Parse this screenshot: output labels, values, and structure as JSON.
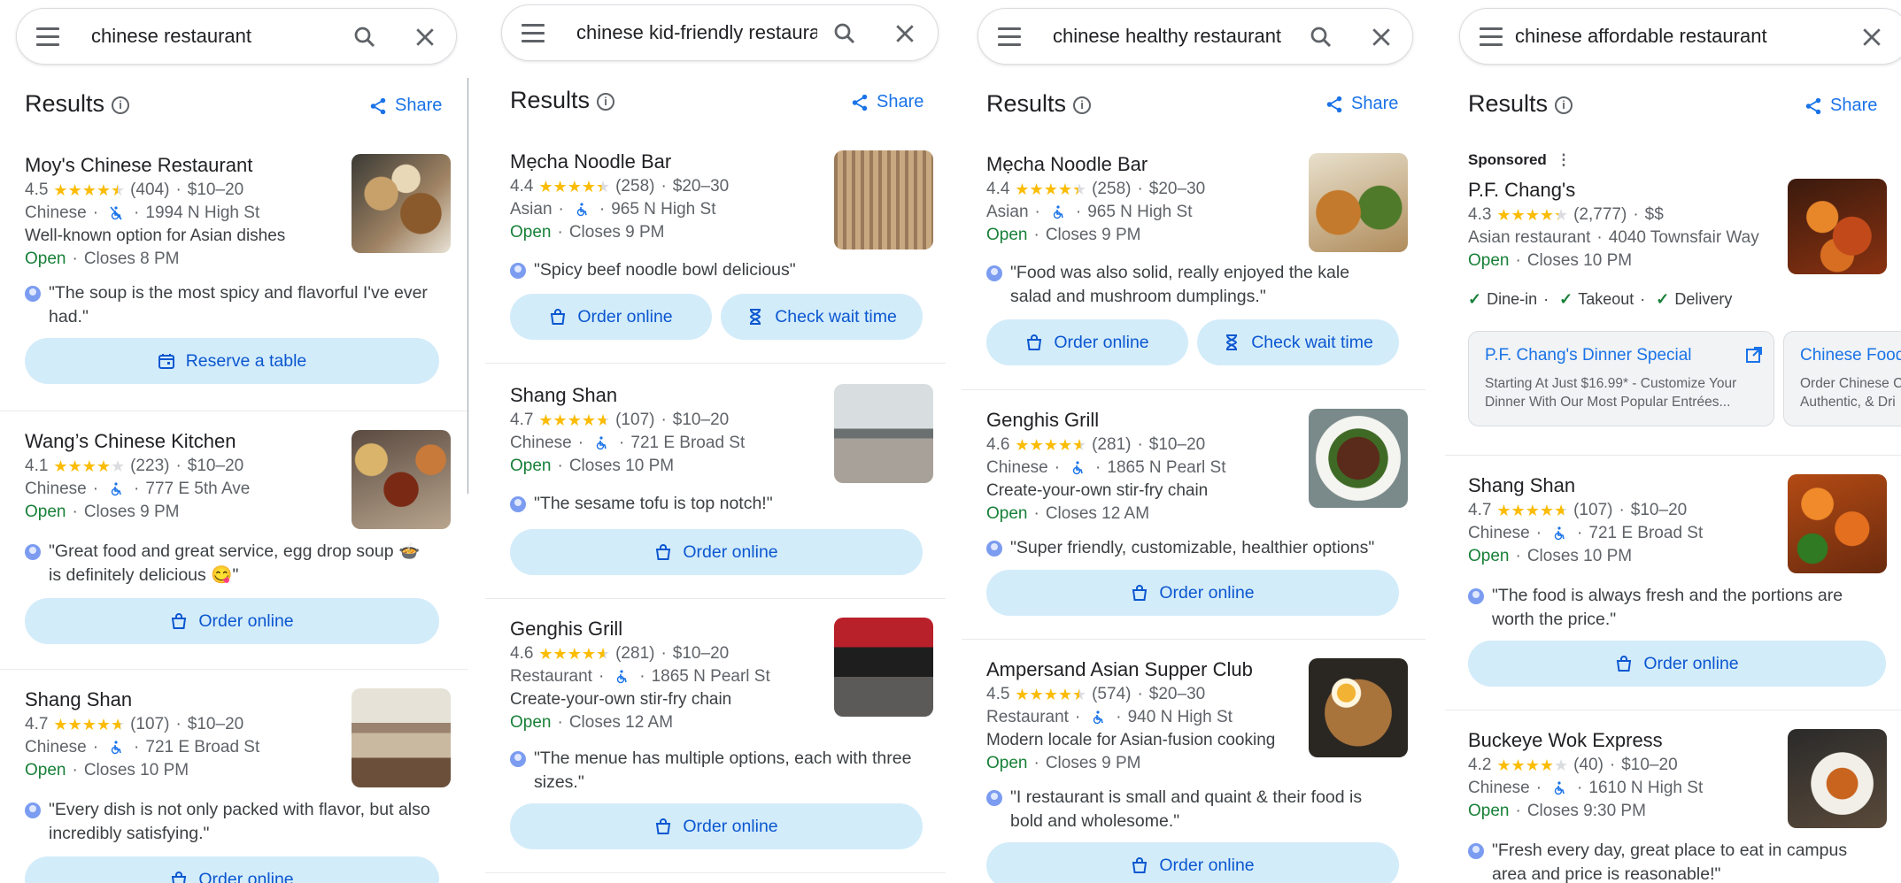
{
  "columns": [
    {
      "query": "chinese restaurant",
      "results_label": "Results",
      "share_label": "Share",
      "items": [
        {
          "name": "Moy's Chinese Restaurant",
          "rating": "4.5",
          "stars": 4.5,
          "reviews": "(404)",
          "price": "$10–20",
          "category": "Chinese",
          "address": "1994 N High St",
          "access": "no-wheelchair",
          "desc": "Well-known option for Asian dishes",
          "status": "Open",
          "closes": "Closes 8 PM",
          "review": "\"The soup is the most spicy and flavorful I've ever had.\"",
          "action": "Reserve a table",
          "photo": "grilled-platter"
        },
        {
          "name": "Wang’s Chinese Kitchen",
          "rating": "4.1",
          "stars": 4,
          "reviews": "(223)",
          "price": "$10–20",
          "category": "Chinese",
          "address": "777 E 5th Ave",
          "access": "wheelchair",
          "desc": "",
          "status": "Open",
          "closes": "Closes 9 PM",
          "review": "\"Great food and great service, egg drop soup 🍲 is definitely delicious 😋\"",
          "action": "Order online",
          "photo": "buffet-tray"
        },
        {
          "name": "Shang Shan",
          "rating": "4.7",
          "stars": 4.5,
          "reviews": "(107)",
          "price": "$10–20",
          "category": "Chinese",
          "address": "721 E Broad St",
          "access": "wheelchair",
          "desc": "",
          "status": "Open",
          "closes": "Closes 10 PM",
          "review": "\"Every dish is not only packed with flavor, but also incredibly satisfying.\"",
          "action": "Order online",
          "photo": "dining-room"
        }
      ]
    },
    {
      "query": "chinese kid-friendly restaurar",
      "results_label": "Results",
      "share_label": "Share",
      "items": [
        {
          "name": "Mẹcha Noodle Bar",
          "rating": "4.4",
          "stars": 4.5,
          "reviews": "(258)",
          "price": "$20–30",
          "category": "Asian",
          "address": "965 N High St",
          "access": "wheelchair",
          "desc": "",
          "status": "Open",
          "closes": "Closes 9 PM",
          "review": "\"Spicy beef noodle bowl delicious\"",
          "actions": [
            "Order online",
            "Check wait time"
          ],
          "photo": "bar-interior"
        },
        {
          "name": "Shang Shan",
          "rating": "4.7",
          "stars": 4.5,
          "reviews": "(107)",
          "price": "$10–20",
          "category": "Chinese",
          "address": "721 E Broad St",
          "access": "wheelchair",
          "desc": "",
          "status": "Open",
          "closes": "Closes 10 PM",
          "review": "\"The sesame tofu is top notch!\"",
          "actions": [
            "Order online"
          ],
          "photo": "dining-room"
        },
        {
          "name": "Genghis Grill",
          "rating": "4.6",
          "stars": 4.5,
          "reviews": "(281)",
          "price": "$10–20",
          "category": "Restaurant",
          "address": "1865 N Pearl St",
          "access": "wheelchair",
          "desc": "Create-your-own stir-fry chain",
          "status": "Open",
          "closes": "Closes 12 AM",
          "review": "\"The menue has multiple options, each with three sizes.\"",
          "actions": [
            "Order online"
          ],
          "photo": "grill-counter"
        }
      ]
    },
    {
      "query": "chinese healthy restaurant",
      "results_label": "Results",
      "share_label": "Share",
      "items": [
        {
          "name": "Mẹcha Noodle Bar",
          "rating": "4.4",
          "stars": 4.5,
          "reviews": "(258)",
          "price": "$20–30",
          "category": "Asian",
          "address": "965 N High St",
          "access": "wheelchair",
          "desc": "",
          "status": "Open",
          "closes": "Closes 9 PM",
          "review": "\"Food was also solid, really enjoyed the kale salad and mushroom dumplings.\"",
          "actions": [
            "Order online",
            "Check wait time"
          ],
          "photo": "noodle-bowls"
        },
        {
          "name": "Genghis Grill",
          "rating": "4.6",
          "stars": 4.5,
          "reviews": "(281)",
          "price": "$10–20",
          "category": "Chinese",
          "address": "1865 N Pearl St",
          "access": "wheelchair",
          "desc": "Create-your-own stir-fry chain",
          "status": "Open",
          "closes": "Closes 12 AM",
          "review": "\"Super friendly, customizable, healthier options\"",
          "actions": [
            "Order online"
          ],
          "photo": "stir-fry-plate"
        },
        {
          "name": "Ampersand Asian Supper Club",
          "rating": "4.5",
          "stars": 4.5,
          "reviews": "(574)",
          "price": "$20–30",
          "category": "Restaurant",
          "address": "940 N High St",
          "access": "wheelchair",
          "desc": "Modern locale for Asian-fusion cooking",
          "status": "Open",
          "closes": "Closes 9 PM",
          "review": "\"I restaurant is small and quaint & their food is bold and wholesome.\"",
          "actions": [
            "Order online"
          ],
          "photo": "ramen-bowl"
        }
      ]
    },
    {
      "query": "chinese affordable restaurant",
      "results_label": "Results",
      "share_label": "Share",
      "sponsored_label": "Sponsored",
      "sponsored": {
        "name": "P.F. Chang's",
        "rating": "4.3",
        "stars": 4.5,
        "reviews": "(2,777)",
        "price": "$$",
        "category": "Asian restaurant",
        "address": "4040 Townsfair Way",
        "status": "Open",
        "closes": "Closes 10 PM",
        "features": [
          "Dine-in",
          "Takeout",
          "Delivery"
        ],
        "photo": "orange-chicken"
      },
      "ads": [
        {
          "title": "P.F. Chang's Dinner Special",
          "line1": "Starting At Just $16.99* - Customize Your",
          "line2": "Dinner With Our Most Popular Entrées..."
        },
        {
          "title": "Chinese Food",
          "line1": "Order Chinese C",
          "line2": "Authentic, & Dri"
        }
      ],
      "items": [
        {
          "name": "Shang Shan",
          "rating": "4.7",
          "stars": 4.5,
          "reviews": "(107)",
          "price": "$10–20",
          "category": "Chinese",
          "address": "721 E Broad St",
          "access": "wheelchair",
          "desc": "",
          "status": "Open",
          "closes": "Closes 10 PM",
          "review": "\"The food is always fresh and the portions are worth the price.\"",
          "actions": [
            "Order online"
          ],
          "photo": "glazed-chicken"
        },
        {
          "name": "Buckeye Wok Express",
          "rating": "4.2",
          "stars": 4,
          "reviews": "(40)",
          "price": "$10–20",
          "category": "Chinese",
          "address": "1610 N High St",
          "access": "wheelchair",
          "desc": "",
          "status": "Open",
          "closes": "Closes 9:30 PM",
          "review": "\"Fresh every day, great place to eat in campus area and price is reasonable!\"",
          "actions": [],
          "photo": "takeout-plate"
        }
      ]
    }
  ],
  "colors": {
    "accent": "#1a73e8",
    "open": "#188038",
    "button_bg": "#d3ecfa",
    "star": "#fbbc04"
  }
}
